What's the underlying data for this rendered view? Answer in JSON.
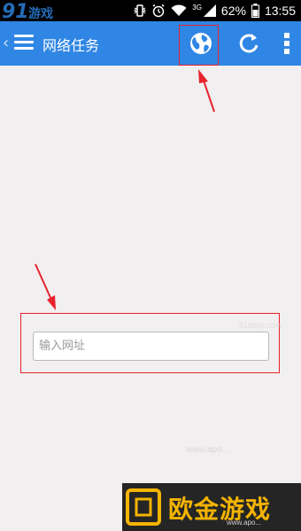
{
  "status_bar": {
    "battery_percent": "62%",
    "time": "13:55",
    "network": "3G",
    "watermark_text": "91游戏"
  },
  "app_bar": {
    "title": "网络任务",
    "icons": [
      "back-chevron-icon",
      "menu-icon",
      "globe-icon",
      "refresh-icon",
      "more-vert-icon"
    ]
  },
  "url_input": {
    "placeholder": "输入网址",
    "value": ""
  },
  "watermarks": {
    "site_text": "91danji.com",
    "bottom_text": "欧金游戏",
    "bottom_url": "www.apo...",
    "faint_url": "www.apo..."
  },
  "colors": {
    "app_bar": "#2f86e4",
    "background": "#f1efef",
    "annotation": "#e8222d"
  }
}
